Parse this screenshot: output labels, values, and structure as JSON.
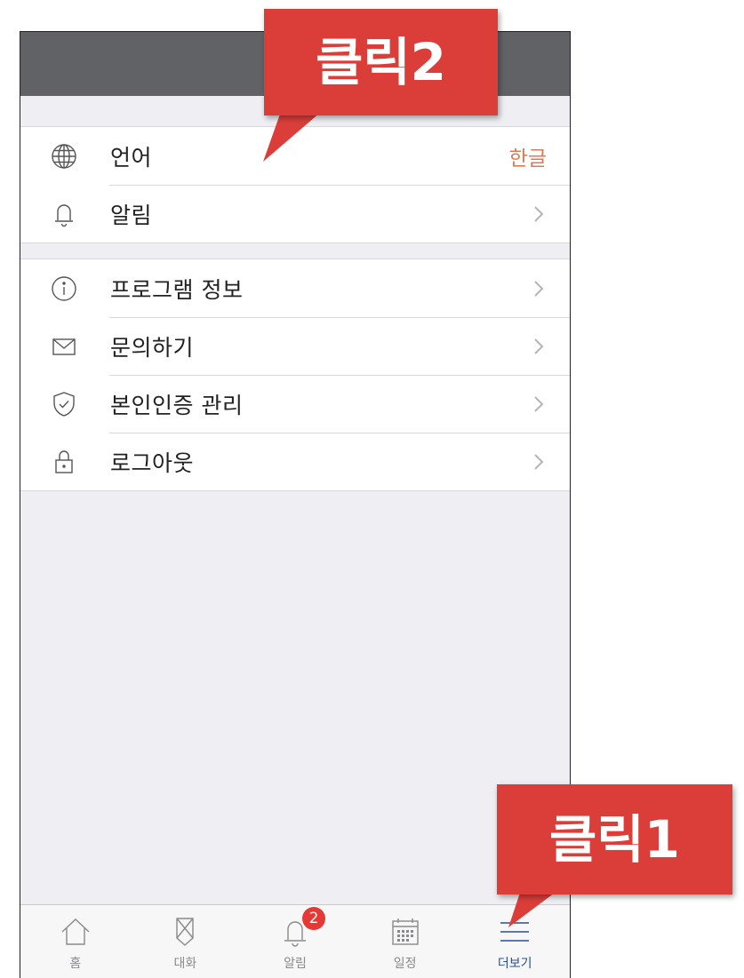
{
  "settings": {
    "group1": [
      {
        "icon": "globe-icon",
        "label": "언어",
        "value": "한글"
      },
      {
        "icon": "bell-icon",
        "label": "알림"
      }
    ],
    "group2": [
      {
        "icon": "info-icon",
        "label": "프로그램 정보"
      },
      {
        "icon": "mail-icon",
        "label": "문의하기"
      },
      {
        "icon": "shield-check-icon",
        "label": "본인인증 관리"
      },
      {
        "icon": "lock-icon",
        "label": "로그아웃"
      }
    ]
  },
  "tabbar": {
    "tabs": [
      {
        "icon": "home-icon",
        "label": "홈"
      },
      {
        "icon": "chat-icon",
        "label": "대화"
      },
      {
        "icon": "bell-icon",
        "label": "알림",
        "badge": "2"
      },
      {
        "icon": "calendar-icon",
        "label": "일정"
      },
      {
        "icon": "menu-icon",
        "label": "더보기",
        "active": true
      }
    ]
  },
  "callouts": {
    "click1": "클릭1",
    "click2": "클릭2"
  },
  "colors": {
    "header": "#616266",
    "accent_value": "#e07a56",
    "active_tab": "#2b4f95",
    "badge": "#e53935",
    "callout": "#db3e39"
  }
}
